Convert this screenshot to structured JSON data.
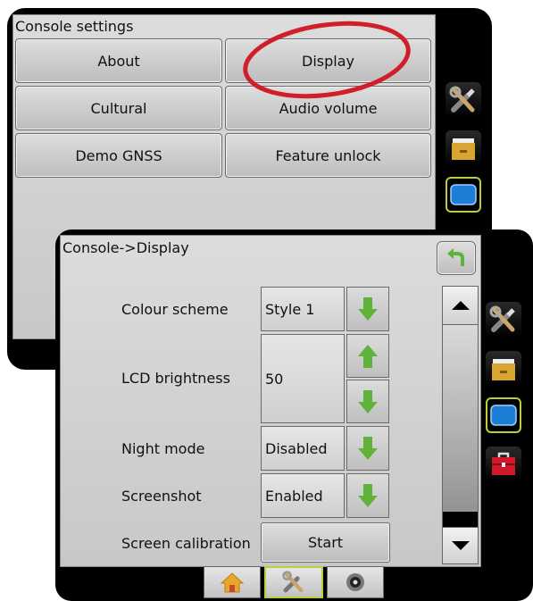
{
  "back_panel": {
    "title": "Console settings",
    "buttons": [
      "About",
      "Display",
      "Cultural",
      "Audio volume",
      "Demo GNSS",
      "Feature unlock"
    ]
  },
  "front_panel": {
    "title": "Console->Display",
    "rows": {
      "colour_scheme": {
        "label": "Colour scheme",
        "value": "Style 1"
      },
      "lcd_brightness": {
        "label": "LCD brightness",
        "value": "50"
      },
      "night_mode": {
        "label": "Night mode",
        "value": "Disabled"
      },
      "screenshot": {
        "label": "Screenshot",
        "value": "Enabled"
      },
      "screen_calibration": {
        "label": "Screen calibration",
        "button": "Start"
      }
    }
  },
  "colors": {
    "highlight_circle": "#d01e2a",
    "selected_border": "#b7d137",
    "arrow_green": "#5fb33a",
    "monitor_blue": "#1d7ed6",
    "toolbox_red": "#d3182b"
  },
  "icons": [
    "tools-icon",
    "folder-icon",
    "monitor-icon",
    "toolbox-icon",
    "back-arrow-icon",
    "home-icon",
    "camera-icon",
    "scroll-up-icon",
    "scroll-down-icon"
  ]
}
